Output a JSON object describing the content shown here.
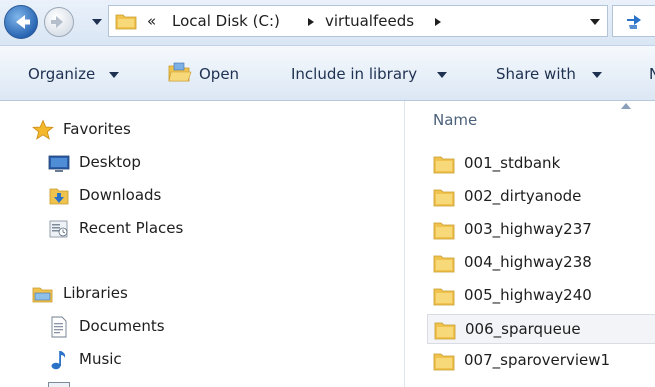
{
  "address": {
    "overflow": "«",
    "crumbs": [
      "Local Disk (C:)",
      "virtualfeeds"
    ]
  },
  "toolbar": {
    "organize": "Organize",
    "open": "Open",
    "include": "Include in library",
    "share": "Share with",
    "overflow": "N"
  },
  "nav": {
    "favorites": "Favorites",
    "desktop": "Desktop",
    "downloads": "Downloads",
    "recent": "Recent Places",
    "libraries": "Libraries",
    "documents": "Documents",
    "music": "Music"
  },
  "content": {
    "column_name": "Name",
    "folders": [
      "001_stdbank",
      "002_dirtyanode",
      "003_highway237",
      "004_highway238",
      "005_highway240",
      "006_sparqueue",
      "007_sparoverview1"
    ],
    "hovered_index": 5
  },
  "colors": {
    "folder": "#f0c34f",
    "accent": "#2a66b3"
  },
  "icons": {
    "back": "back-arrow-icon",
    "forward": "forward-arrow-icon",
    "refresh": "refresh-icon",
    "folder": "folder-icon",
    "star": "star-icon",
    "desktop": "desktop-icon",
    "downloads": "downloads-folder-icon",
    "recent": "recent-places-icon",
    "libraries": "libraries-icon",
    "documents": "documents-icon",
    "music": "music-icon"
  }
}
